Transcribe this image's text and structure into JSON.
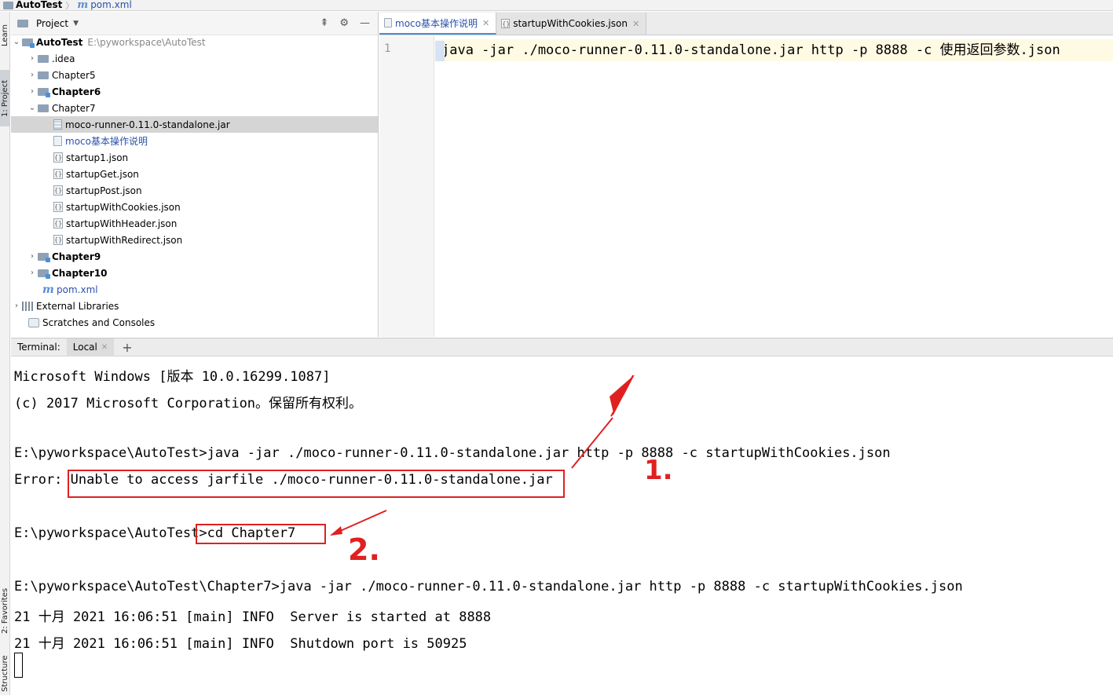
{
  "breadcrumb": {
    "project": "AutoTest",
    "file": "pom.xml"
  },
  "tool_strip": {
    "learn": "Learn",
    "project": "1: Project",
    "favorites": "2: Favorites",
    "structure": "Structure"
  },
  "project_panel": {
    "title": "Project",
    "tree": [
      {
        "label": "AutoTest",
        "path": "E:\\pyworkspace\\AutoTest"
      },
      {
        "label": ".idea"
      },
      {
        "label": "Chapter5"
      },
      {
        "label": "Chapter6"
      },
      {
        "label": "Chapter7"
      },
      {
        "label": "moco-runner-0.11.0-standalone.jar"
      },
      {
        "label": "moco基本操作说明"
      },
      {
        "label": "startup1.json"
      },
      {
        "label": "startupGet.json"
      },
      {
        "label": "startupPost.json"
      },
      {
        "label": "startupWithCookies.json"
      },
      {
        "label": "startupWithHeader.json"
      },
      {
        "label": "startupWithRedirect.json"
      },
      {
        "label": "Chapter9"
      },
      {
        "label": "Chapter10"
      },
      {
        "label": "pom.xml"
      },
      {
        "label": "External Libraries"
      },
      {
        "label": "Scratches and Consoles"
      }
    ]
  },
  "editor": {
    "tabs": [
      {
        "label": "moco基本操作说明"
      },
      {
        "label": "startupWithCookies.json"
      }
    ],
    "line_number": "1",
    "code": "java -jar ./moco-runner-0.11.0-standalone.jar http -p 8888 -c 使用返回参数.json"
  },
  "terminal": {
    "label": "Terminal:",
    "tab": "Local",
    "lines": [
      "Microsoft Windows [版本 10.0.16299.1087]",
      "(c) 2017 Microsoft Corporation。保留所有权利。",
      "",
      "E:\\pyworkspace\\AutoTest>java -jar ./moco-runner-0.11.0-standalone.jar http -p 8888 -c startupWithCookies.json",
      "Error: Unable to access jarfile ./moco-runner-0.11.0-standalone.jar",
      "",
      "E:\\pyworkspace\\AutoTest>cd Chapter7",
      "",
      "E:\\pyworkspace\\AutoTest\\Chapter7>java -jar ./moco-runner-0.11.0-standalone.jar http -p 8888 -c startupWithCookies.json",
      "21 十月 2021 16:06:51 [main] INFO  Server is started at 8888",
      "21 十月 2021 16:06:51 [main] INFO  Shutdown port is 50925"
    ]
  },
  "annotations": {
    "label1": "1.",
    "label2": "2.",
    "color": "#e02020"
  }
}
